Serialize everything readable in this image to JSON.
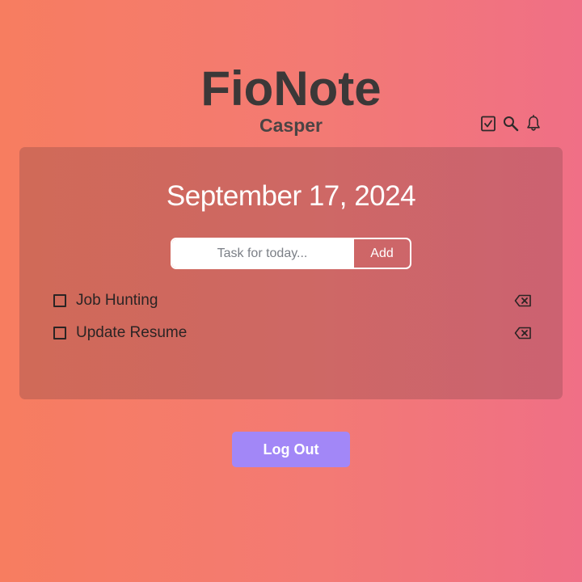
{
  "header": {
    "app_title": "FioNote",
    "user_name": "Casper"
  },
  "toolbar": {
    "icons": [
      "checkbox-check-icon",
      "search-icon",
      "bell-icon"
    ]
  },
  "todo": {
    "date": "September 17, 2024",
    "input": {
      "placeholder": "Task for today...",
      "value": ""
    },
    "add_label": "Add",
    "tasks": [
      {
        "label": "Job Hunting",
        "done": false
      },
      {
        "label": "Update Resume",
        "done": false
      }
    ]
  },
  "footer": {
    "logout_label": "Log Out"
  },
  "colors": {
    "accent_button": "#a287f7",
    "title_text": "#3b3838",
    "task_text": "#2b2424"
  }
}
